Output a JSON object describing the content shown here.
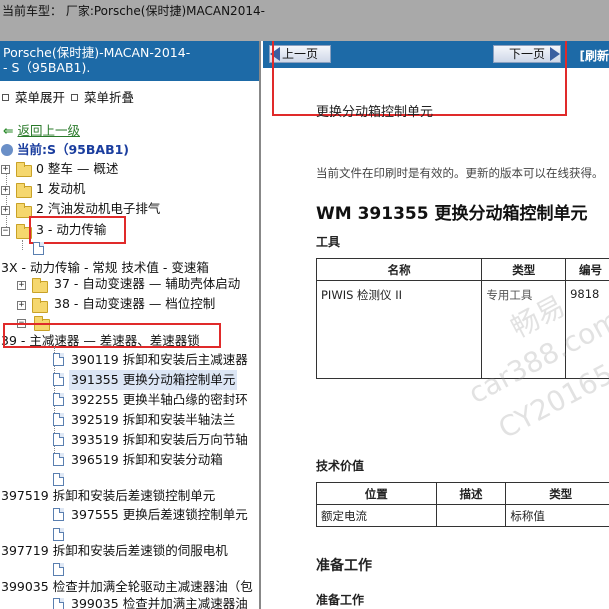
{
  "header": {
    "vehicle": "当前车型： 厂家:Porsche(保时捷)MACAN2014-"
  },
  "left": {
    "title_line1": "Porsche(保时捷)-MACAN-2014-",
    "title_line2": "- S（95BAB1).",
    "expand_all": "菜单展开",
    "collapse_all": "菜单折叠",
    "back": "返回上一级",
    "current": "当前:S（95BAB1)",
    "tree": {
      "n0": "0 整车 — 概述",
      "n1": "1 发动机",
      "n2": "2 汽油发动机电子排气",
      "n3": "3 - 动力传输",
      "n3x": "3X - 动力传输 - 常规 技术值 - 变速箱",
      "n37": "37 - 自动变速器 — 辅助壳体启动",
      "n38": "38 - 自动变速器 — 档位控制",
      "n39": "39 - 主减速器 — 差速器、差速器锁",
      "d390119": "390119 拆卸和安装后主减速器",
      "d391355": "391355 更换分动箱控制单元",
      "d392255": "392255 更换半轴凸缘的密封环",
      "d392519": "392519 拆卸和安装半轴法兰",
      "d393519": "393519 拆卸和安装后万向节轴",
      "d396519": "396519 拆卸和安装分动箱",
      "n397519": "397519 拆卸和安装后差速锁控制单元",
      "d397555": "397555 更换后差速锁控制单元",
      "n397719": "397719 拆卸和安装后差速锁的伺服电机",
      "n399035": "399035 检查并加满全轮驱动主减速器油（包",
      "d399035": "399035 检查并加满主减速器油"
    }
  },
  "right": {
    "prev_page": "上一页",
    "next_page": "下一页",
    "refresh": "[刷新",
    "doc_heading": "更换分动箱控制单元",
    "notice": "当前文件在印刷时是有效的。更新的版本可以在线获得。",
    "title": "WM 391355 更换分动箱控制单元",
    "tools_label": "工具",
    "tools_table": {
      "headers": [
        "名称",
        "类型",
        "编号"
      ],
      "rows": [
        [
          "PIWIS 检测仪 II",
          "专用工具",
          "9818"
        ]
      ]
    },
    "tech_label": "技术价值",
    "tech_table": {
      "headers": [
        "位置",
        "描述",
        "类型"
      ],
      "rows": [
        [
          "额定电流",
          "",
          "标称值"
        ]
      ]
    },
    "prep_label": "准备工作",
    "prep_sub": "准备工作",
    "watermark_1": "畅易",
    "watermark_2": "car388.com",
    "watermark_3": "CY20165"
  }
}
